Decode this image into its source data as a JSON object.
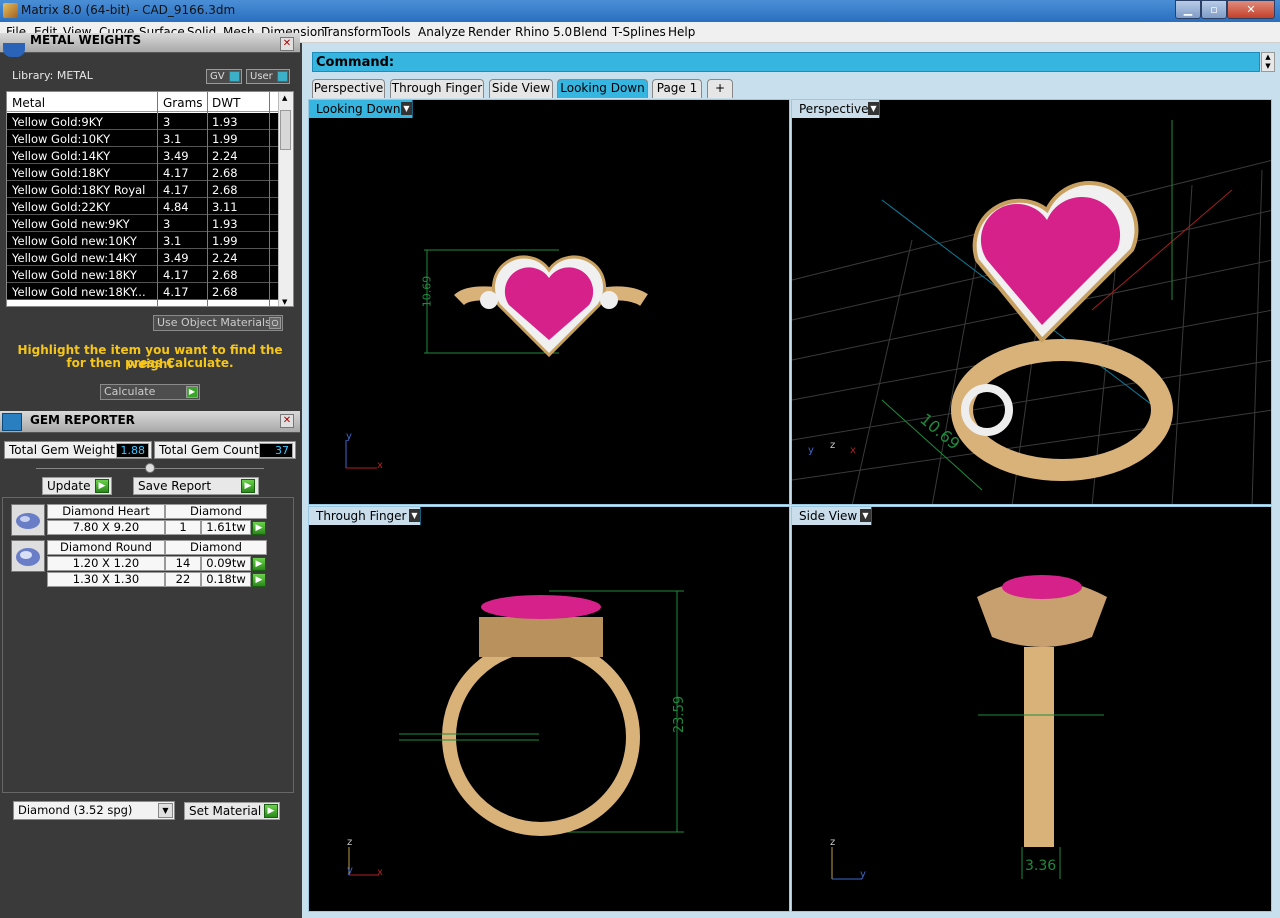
{
  "window": {
    "title": "Matrix 8.0 (64-bit) - CAD_9166.3dm",
    "min": "▁",
    "max": "▫",
    "close": "✕"
  },
  "menu": [
    "File",
    "Edit",
    "View",
    "Curve",
    "Surface",
    "Solid",
    "Mesh",
    "Dimension",
    "Transform",
    "Tools",
    "Analyze",
    "Render",
    "Rhino 5.0",
    "Blend",
    "T-Splines",
    "Help"
  ],
  "metal_panel": {
    "title": "METAL WEIGHTS",
    "library_label": "Library: METAL",
    "gv_label": "GV",
    "user_label": "User",
    "columns": [
      "Metal",
      "Grams",
      "DWT"
    ],
    "rows": [
      [
        "Yellow Gold:9KY",
        "3",
        "1.93"
      ],
      [
        "Yellow Gold:10KY",
        "3.1",
        "1.99"
      ],
      [
        "Yellow Gold:14KY",
        "3.49",
        "2.24"
      ],
      [
        "Yellow Gold:18KY",
        "4.17",
        "2.68"
      ],
      [
        "Yellow Gold:18KY Royal",
        "4.17",
        "2.68"
      ],
      [
        "Yellow Gold:22KY",
        "4.84",
        "3.11"
      ],
      [
        "Yellow Gold new:9KY",
        "3",
        "1.93"
      ],
      [
        "Yellow Gold new:10KY",
        "3.1",
        "1.99"
      ],
      [
        "Yellow Gold new:14KY",
        "3.49",
        "2.24"
      ],
      [
        "Yellow Gold new:18KY",
        "4.17",
        "2.68"
      ],
      [
        "Yellow Gold new:18KY...",
        "4.17",
        "2.68"
      ]
    ],
    "use_object_materials": "Use Object Materials",
    "instruction_line1": "Highlight the item you want to find the weight",
    "instruction_line2": "for then press Calculate.",
    "calculate": "Calculate"
  },
  "gem_panel": {
    "title": "GEM REPORTER",
    "total_weight_label": "Total Gem Weight",
    "total_weight_value": "1.88",
    "total_count_label": "Total Gem Count",
    "total_count_value": "37",
    "update": "Update",
    "save_report": "Save Report",
    "groups": [
      {
        "name": "Diamond Heart",
        "material": "Diamond",
        "items": [
          {
            "size": "7.80 X 9.20",
            "count": "1",
            "tw": "1.61tw"
          }
        ]
      },
      {
        "name": "Diamond Round",
        "material": "Diamond",
        "items": [
          {
            "size": "1.20 X 1.20",
            "count": "14",
            "tw": "0.09tw"
          },
          {
            "size": "1.30 X 1.30",
            "count": "22",
            "tw": "0.18tw"
          }
        ]
      }
    ],
    "material_select": "Diamond     (3.52 spg)",
    "set_material": "Set Material"
  },
  "command": {
    "label": "Command:"
  },
  "tabs": [
    "Perspective",
    "Through Finger",
    "Side View",
    "Looking Down",
    "Page 1",
    "+"
  ],
  "active_tab": "Looking Down",
  "viewports": {
    "top_left": {
      "label": "Looking Down",
      "dimension": "10.69"
    },
    "top_right": {
      "label": "Perspective",
      "dimension": "10.69"
    },
    "bottom_left": {
      "label": "Through Finger",
      "dimension": "23.59"
    },
    "bottom_right": {
      "label": "Side View",
      "dimension": "3.36"
    }
  },
  "colors": {
    "accent": "#36b5e0",
    "gem": "#d6208a",
    "gold": "#d9b27a",
    "dim": "#1f8a3c"
  }
}
